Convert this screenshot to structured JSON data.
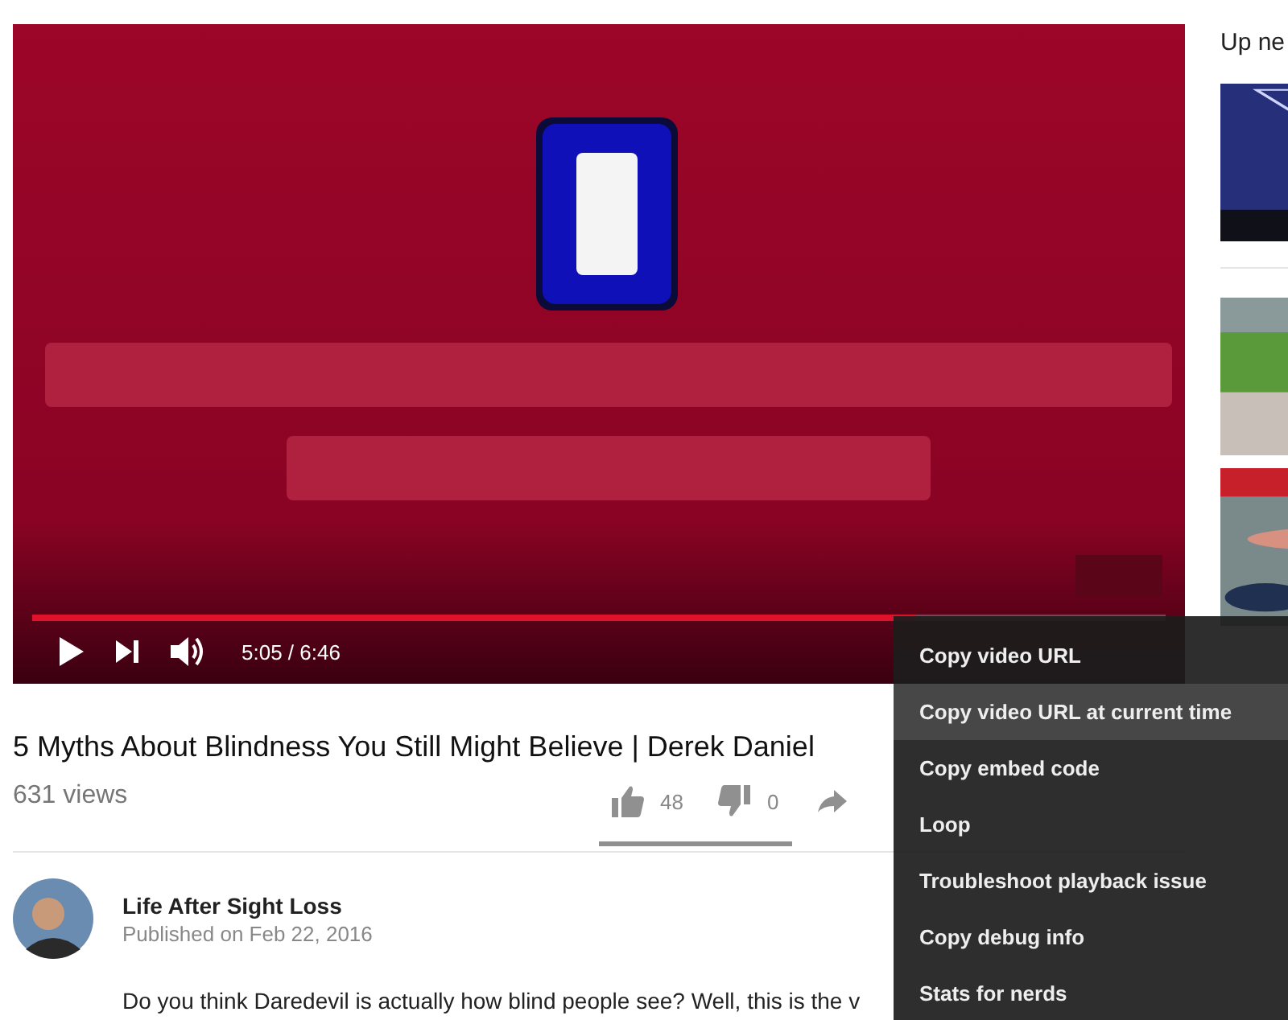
{
  "player": {
    "progress": {
      "level": 0.78
    },
    "time": "5:05 / 6:46"
  },
  "video": {
    "title": "5 Myths About Blindness You Still Might Believe | Derek Daniel",
    "views": "631 views",
    "likes": "48",
    "dislikes": "0"
  },
  "channel": {
    "name": "Life After Sight Loss",
    "published": "Published on Feb 22, 2016"
  },
  "description": "Do you think Daredevil is actually how blind people see? Well, this is the v",
  "sidebar": {
    "heading": "Up ne"
  },
  "context_menu": [
    {
      "label": "Copy video URL",
      "selected": false
    },
    {
      "label": "Copy video URL at current time",
      "selected": true
    },
    {
      "label": "Copy embed code",
      "selected": false
    },
    {
      "label": "Loop",
      "selected": false
    },
    {
      "label": "Troubleshoot playback issue",
      "selected": false
    },
    {
      "label": "Copy debug info",
      "selected": false
    },
    {
      "label": "Stats for nerds",
      "selected": false
    }
  ]
}
